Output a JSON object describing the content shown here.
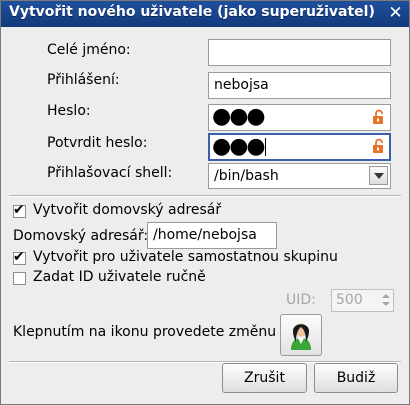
{
  "window": {
    "title": "Vytvořit nového uživatele (jako superuživatel)"
  },
  "form": {
    "full_name": {
      "label": "Celé jméno:",
      "value": ""
    },
    "login": {
      "label": "Přihlášení:",
      "value": "nebojsa"
    },
    "password": {
      "label": "Heslo:",
      "value": "●●●"
    },
    "confirm_password": {
      "label": "Potvrdit heslo:",
      "value": "●●●"
    },
    "shell": {
      "label": "Přihlašovací shell:",
      "value": "/bin/bash"
    }
  },
  "options": {
    "create_home": {
      "label": "Vytvořit domovský adresář",
      "checked": true
    },
    "home_dir": {
      "label": "Domovský adresář:",
      "value": "/home/nebojsa"
    },
    "create_group": {
      "label": "Vytvořit pro uživatele samostatnou skupinu",
      "checked": true
    },
    "manual_uid": {
      "label": "Zadat ID uživatele ručně",
      "checked": false
    },
    "uid": {
      "label": "UID:",
      "value": "500"
    }
  },
  "icon_change": {
    "label": "Klepnutím na ikonu provedete změnu",
    "icon": "user-avatar-icon"
  },
  "buttons": {
    "cancel": "Zrušit",
    "next": "Budiž"
  },
  "colors": {
    "titlebar": "#1a4690",
    "lock": "#e8722a",
    "window_bg": "#ededed"
  }
}
